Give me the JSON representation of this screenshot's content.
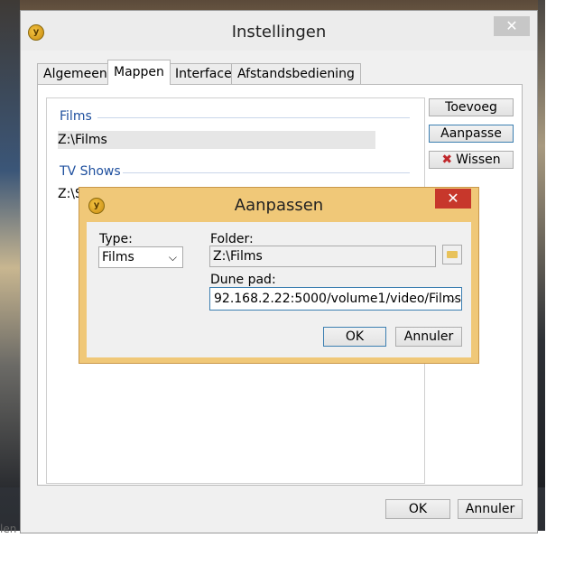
{
  "window": {
    "title": "Instellingen",
    "close_glyph": "✕"
  },
  "tabs": [
    {
      "label": "Algemeen"
    },
    {
      "label": "Mappen"
    },
    {
      "label": "Interface"
    },
    {
      "label": "Afstandsbediening"
    }
  ],
  "folders": {
    "groups": [
      {
        "header": "Films",
        "items": [
          "Z:\\Films"
        ]
      },
      {
        "header": "TV Shows",
        "items": [
          "Z:\\S"
        ]
      }
    ]
  },
  "side_buttons": {
    "add": "Toevoeg",
    "edit": "Aanpasse",
    "delete": "Wissen"
  },
  "footer": {
    "ok": "OK",
    "cancel": "Annuler"
  },
  "dialog": {
    "title": "Aanpassen",
    "close_glyph": "✕",
    "type_label": "Type:",
    "type_value": "Films",
    "folder_label": "Folder:",
    "folder_value": "Z:\\Films",
    "dune_label": "Dune pad:",
    "dune_value": "92.168.2.22:5000/volume1/video/Films",
    "ok": "OK",
    "cancel": "Annuler"
  },
  "background": {
    "caption": "len"
  },
  "colors": {
    "dialog_frame": "#f0c878",
    "dialog_close": "#c7372b",
    "group_header": "#1e4f9e",
    "delete_icon": "#c0282c"
  }
}
